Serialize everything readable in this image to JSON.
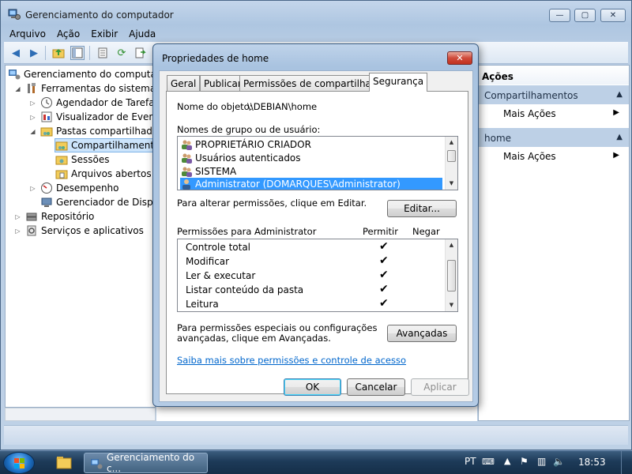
{
  "window": {
    "title": "Gerenciamento do computador",
    "controls": {
      "minimize": "—",
      "maximize": "▢",
      "close": "✕"
    }
  },
  "menu": [
    "Arquivo",
    "Ação",
    "Exibir",
    "Ajuda"
  ],
  "tree": {
    "root": "Gerenciamento do computador",
    "system_tools": "Ferramentas do sistema",
    "task_scheduler": "Agendador de Tarefas",
    "event_viewer": "Visualizador de Eventos",
    "shared_folders": "Pastas compartilhadas",
    "shares": "Compartilhamentos",
    "sessions": "Sessões",
    "open_files": "Arquivos abertos",
    "performance": "Desempenho",
    "device_manager": "Gerenciador de Dispositivos",
    "storage": "Repositório",
    "services_apps": "Serviços e aplicativos"
  },
  "actions": {
    "header": "Ações",
    "section1": "Compartilhamentos",
    "more1": "Mais Ações",
    "section2": "home",
    "more2": "Mais Ações"
  },
  "dialog": {
    "title": "Propriedades de home",
    "close": "✕",
    "tabs": [
      "Geral",
      "Publicar",
      "Permissões de compartilhamento",
      "Segurança"
    ],
    "active_tab": "Segurança",
    "object_label": "Nome do objeto:",
    "object_value": "\\\\DEBIAN\\home",
    "groups_label": "Nomes de grupo ou de usuário:",
    "groups": [
      "PROPRIETÁRIO CRIADOR",
      "Usuários autenticados",
      "SISTEMA",
      "Administrator (DOMARQUES\\Administrator)"
    ],
    "selected_group": "Administrator (DOMARQUES\\Administrator)",
    "edit_hint": "Para alterar permissões, clique em Editar.",
    "edit_button": "Editar...",
    "perms_label": "Permissões para Administrator",
    "allow_header": "Permitir",
    "deny_header": "Negar",
    "permissions": [
      {
        "name": "Controle total",
        "allow": "✔",
        "deny": ""
      },
      {
        "name": "Modificar",
        "allow": "✔",
        "deny": ""
      },
      {
        "name": "Ler & executar",
        "allow": "✔",
        "deny": ""
      },
      {
        "name": "Listar conteúdo da pasta",
        "allow": "✔",
        "deny": ""
      },
      {
        "name": "Leitura",
        "allow": "✔",
        "deny": ""
      }
    ],
    "special_hint_line1": "Para permissões especiais ou configurações",
    "special_hint_line2": "avançadas, clique em Avançadas.",
    "advanced_button": "Avançadas",
    "learn_link": "Saiba mais sobre permissões e controle de acesso",
    "ok": "OK",
    "cancel": "Cancelar",
    "apply": "Aplicar"
  },
  "taskbar": {
    "active_app": "Gerenciamento do c...",
    "language": "PT",
    "clock": "18:53"
  },
  "colors": {
    "selection": "#3399ff",
    "tree_selection": "#cce4fb",
    "action_section": "#bdd0e6",
    "link": "#0066cc",
    "taskbar": "#1d3a58"
  }
}
